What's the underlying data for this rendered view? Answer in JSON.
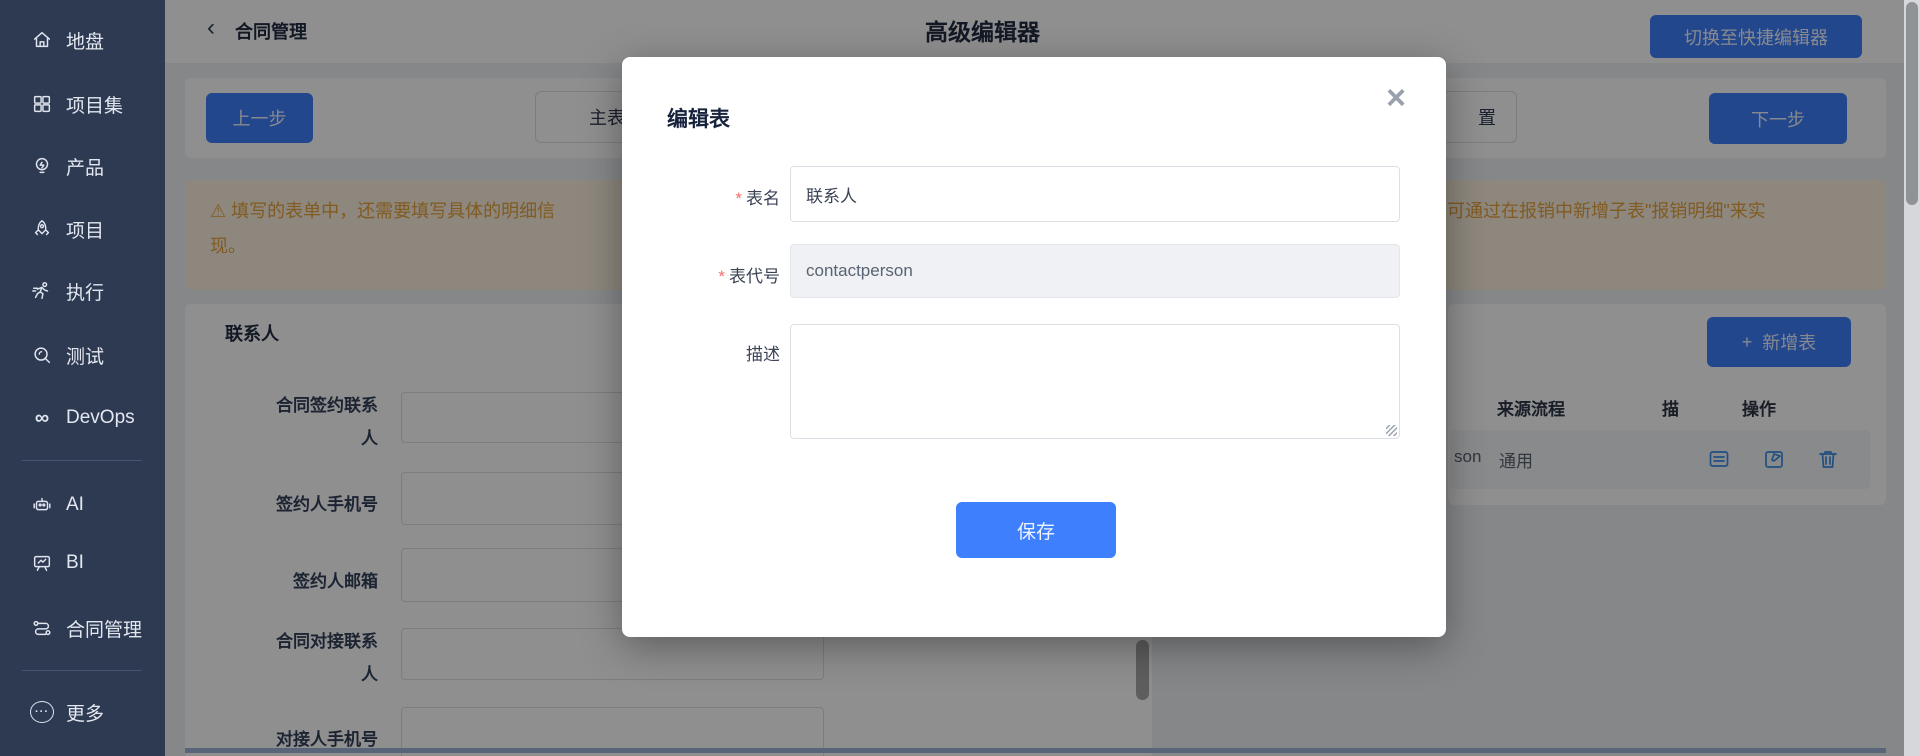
{
  "sidebar": {
    "items": [
      {
        "label": "地盘",
        "icon": "home-icon"
      },
      {
        "label": "项目集",
        "icon": "grid-icon"
      },
      {
        "label": "产品",
        "icon": "bulb-icon"
      },
      {
        "label": "项目",
        "icon": "rocket-icon"
      },
      {
        "label": "执行",
        "icon": "runner-icon"
      },
      {
        "label": "测试",
        "icon": "search-icon"
      },
      {
        "label": "DevOps",
        "icon": "infinity-icon",
        "icon_glyph": "∞"
      },
      {
        "label": "AI",
        "icon": "robot-icon"
      },
      {
        "label": "BI",
        "icon": "chart-board-icon"
      },
      {
        "label": "合同管理",
        "icon": "route-icon"
      },
      {
        "label": "更多",
        "icon": "more-icon",
        "icon_glyph": "···"
      }
    ]
  },
  "header": {
    "back_chevron": "‹",
    "back_label": "合同管理",
    "title": "高级编辑器",
    "switch_button": "切换至快捷编辑器"
  },
  "toolbar": {
    "prev_button": "上一步",
    "next_button": "下一步",
    "step_left_fragment": "主表",
    "step_right_fragment": "置"
  },
  "banner": {
    "icon": "⚠",
    "line1_left": "填写的表单中，还需要填写具体的明细信",
    "line1_right": "可通过在报销中新增子表\"报销明细\"来实",
    "line2": "现。"
  },
  "form_panel": {
    "title": "联系人",
    "rows": [
      {
        "label": "合同签约联系人",
        "value": ""
      },
      {
        "label": "签约人手机号",
        "value": ""
      },
      {
        "label": "签约人邮箱",
        "value": ""
      },
      {
        "label": "合同对接联系人",
        "value": ""
      },
      {
        "label": "对接人手机号",
        "value": ""
      }
    ]
  },
  "tables_panel": {
    "add_button_plus": "+",
    "add_button_label": "新增表",
    "headers": [
      "来源流程",
      "描",
      "操作"
    ],
    "row": {
      "code_fragment": "son",
      "source": "通用",
      "actions": [
        "detail-icon",
        "edit-icon",
        "delete-icon"
      ]
    }
  },
  "modal": {
    "title": "编辑表",
    "close_glyph": "×",
    "required_mark": "*",
    "name_label": "表名",
    "name_value": "联系人",
    "code_label": "表代号",
    "code_value": "contactperson",
    "desc_label": "描述",
    "desc_value": "",
    "save_button": "保存"
  },
  "colors": {
    "primary_blue": "#3d7ffc",
    "warning_orange": "#e6a23c",
    "sidebar_bg": "#2e3a52",
    "row_hover": "#f5f7fa"
  }
}
